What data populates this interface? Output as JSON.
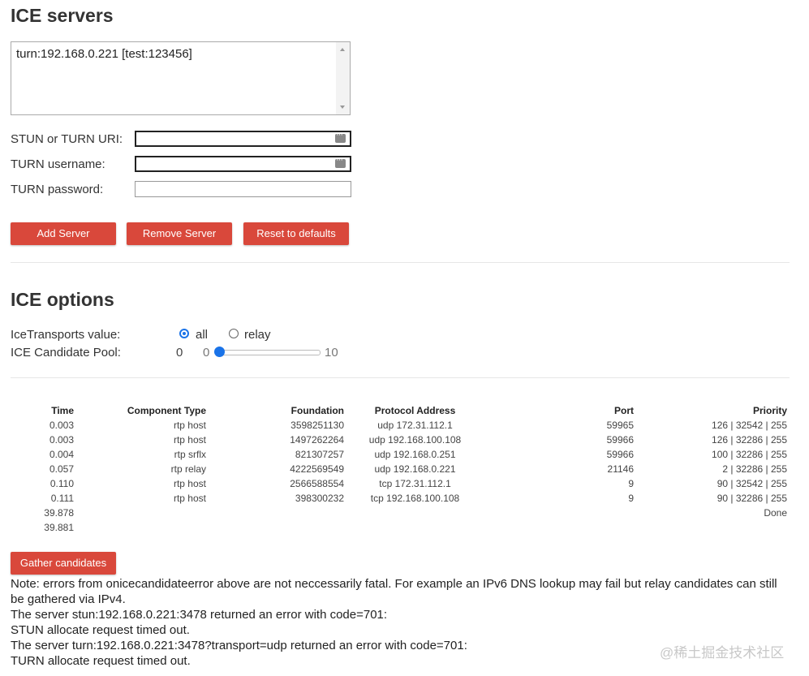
{
  "ice_servers": {
    "heading": "ICE servers",
    "server_list": [
      "turn:192.168.0.221 [test:123456]"
    ],
    "uri_label": "STUN or TURN URI:",
    "username_label": "TURN username:",
    "password_label": "TURN password:",
    "uri_value": "",
    "username_value": "",
    "password_value": "",
    "add_button": "Add Server",
    "remove_button": "Remove Server",
    "reset_button": "Reset to defaults"
  },
  "ice_options": {
    "heading": "ICE options",
    "transports_label": "IceTransports value:",
    "transport_all": "all",
    "transport_relay": "relay",
    "selected_transport": "all",
    "pool_label": "ICE Candidate Pool:",
    "pool_value": "0",
    "slider_min": "0",
    "slider_max": "10",
    "slider_value": 0
  },
  "candidates": {
    "headers": [
      "Time",
      "Component Type",
      "Foundation",
      "Protocol Address",
      "Port",
      "Priority"
    ],
    "rows": [
      {
        "time": "0.003",
        "component": "rtp host",
        "foundation": "3598251130",
        "address": "udp 172.31.112.1",
        "port": "59965",
        "priority": "126 | 32542 | 255"
      },
      {
        "time": "0.003",
        "component": "rtp host",
        "foundation": "1497262264",
        "address": "udp 192.168.100.108",
        "port": "59966",
        "priority": "126 | 32286 | 255"
      },
      {
        "time": "0.004",
        "component": "rtp srflx",
        "foundation": "821307257",
        "address": "udp 192.168.0.251",
        "port": "59966",
        "priority": "100 | 32286 | 255"
      },
      {
        "time": "0.057",
        "component": "rtp relay",
        "foundation": "4222569549",
        "address": "udp 192.168.0.221",
        "port": "21146",
        "priority": "2 | 32286 | 255"
      },
      {
        "time": "0.110",
        "component": "rtp host",
        "foundation": "2566588554",
        "address": "tcp 172.31.112.1",
        "port": "9",
        "priority": "90 | 32542 | 255"
      },
      {
        "time": "0.111",
        "component": "rtp host",
        "foundation": "398300232",
        "address": "tcp 192.168.100.108",
        "port": "9",
        "priority": "90 | 32286 | 255"
      },
      {
        "time": "39.878",
        "component": "",
        "foundation": "",
        "address": "",
        "port": "",
        "priority": "Done"
      },
      {
        "time": "39.881",
        "component": "",
        "foundation": "",
        "address": "",
        "port": "",
        "priority": ""
      }
    ],
    "gather_button": "Gather candidates"
  },
  "errors": {
    "note": "Note: errors from onicecandidateerror above are not neccessarily fatal. For example an IPv6 DNS lookup may fail but relay candidates can still be gathered via IPv4.",
    "line1": "The server stun:192.168.0.221:3478 returned an error with code=701:",
    "line2": "STUN allocate request timed out.",
    "line3": "The server turn:192.168.0.221:3478?transport=udp returned an error with code=701:",
    "line4": "TURN allocate request timed out."
  },
  "watermark": "@稀土掘金技术社区",
  "colors": {
    "button": "#d9483b",
    "accent": "#1a73e8"
  }
}
